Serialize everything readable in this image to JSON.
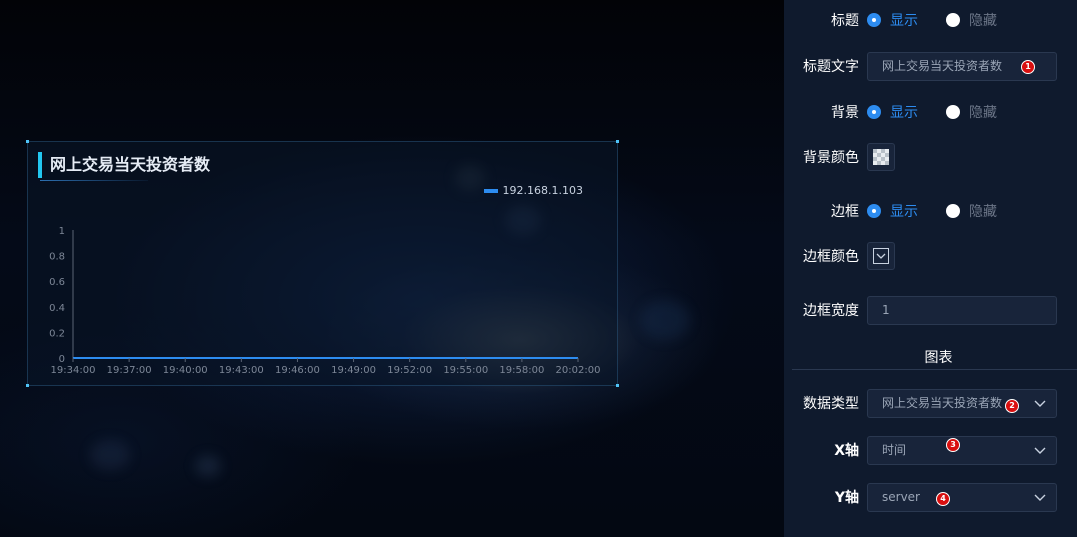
{
  "widget": {
    "title": "网上交易当天投资者数",
    "legend": "192.168.1.103"
  },
  "chart_data": {
    "type": "line",
    "title": "网上交易当天投资者数",
    "series": [
      {
        "name": "192.168.1.103",
        "values": [
          0,
          0,
          0,
          0,
          0,
          0,
          0,
          0,
          0,
          0
        ]
      }
    ],
    "x": [
      "19:34:00",
      "19:37:00",
      "19:40:00",
      "19:43:00",
      "19:46:00",
      "19:49:00",
      "19:52:00",
      "19:55:00",
      "19:58:00",
      "20:02:00"
    ],
    "y_ticks": [
      "1",
      "0.8",
      "0.6",
      "0.4",
      "0.2",
      "0"
    ],
    "ylim": [
      0,
      1
    ],
    "grid": false,
    "legend_position": "top-right",
    "colors": {
      "series": "#2d8cf0",
      "accent": "#22c7f0"
    }
  },
  "panel": {
    "title_row": {
      "label": "标题",
      "show": "显示",
      "hide": "隐藏"
    },
    "title_text": {
      "label": "标题文字",
      "value": "网上交易当天投资者数"
    },
    "background_row": {
      "label": "背景",
      "show": "显示",
      "hide": "隐藏"
    },
    "background_color": {
      "label": "背景颜色"
    },
    "border_row": {
      "label": "边框",
      "show": "显示",
      "hide": "隐藏"
    },
    "border_color": {
      "label": "边框颜色"
    },
    "border_width": {
      "label": "边框宽度",
      "value": "1"
    },
    "section": "图表",
    "data_type": {
      "label": "数据类型",
      "value": "网上交易当天投资者数"
    },
    "x_axis": {
      "label": "X轴",
      "value": "时间"
    },
    "y_axis": {
      "label": "Y轴",
      "value": "server"
    },
    "badges": [
      "1",
      "2",
      "3",
      "4"
    ]
  }
}
